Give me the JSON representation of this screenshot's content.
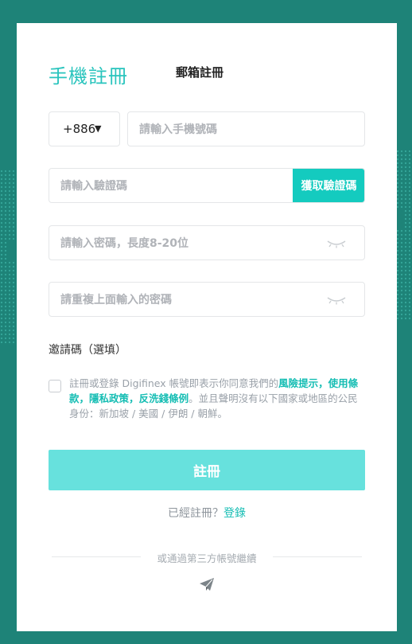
{
  "tabs": {
    "phone_register": "手機註冊",
    "email_register": "郵箱註冊"
  },
  "country": {
    "code": "+886",
    "caret": "▼"
  },
  "phone": {
    "placeholder": "請輸入手機號碼"
  },
  "verification": {
    "placeholder": "請輸入驗證碼",
    "button": "獲取驗證碼"
  },
  "password": {
    "placeholder": "請輸入密碼，長度8-20位",
    "icon": "eye-closed-icon"
  },
  "confirm_password": {
    "placeholder": "請重複上面輸入的密碼",
    "icon": "eye-closed-icon"
  },
  "invite": {
    "label": "邀請碼（選填）"
  },
  "terms": {
    "prefix": "註冊或登錄 Digifinex 帳號即表示你同意我們的",
    "risk": "風險提示",
    "sep1": "，",
    "usage": "使用條款",
    "sep2": "，",
    "privacy": "隱私政策",
    "sep3": "，",
    "aml": "反洗錢條例",
    "suffix": "。並且聲明沒有以下國家或地區的公民身份：新加坡 / 美國 / 伊朗 / 朝鮮。"
  },
  "register_button": "註冊",
  "login": {
    "prompt": "已經註冊？",
    "link": "登錄"
  },
  "third_party": {
    "label": "或通過第三方帳號繼續",
    "icon": "telegram-icon"
  },
  "colors": {
    "accent": "#29c4bd",
    "button": "#14cbbf",
    "register_button": "#67e1dd",
    "background": "#1e8378"
  }
}
